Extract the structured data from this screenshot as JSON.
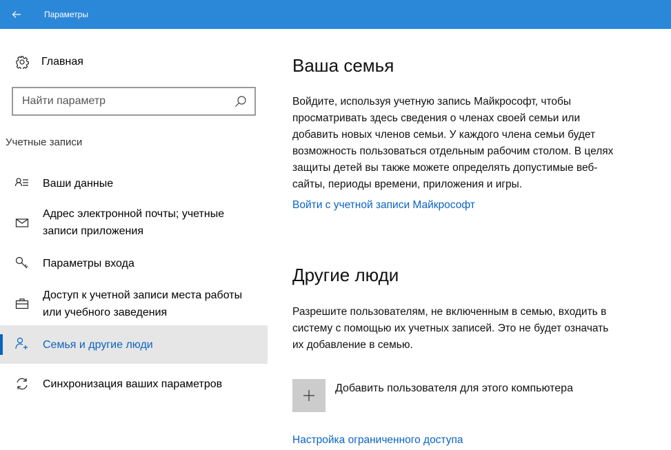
{
  "window": {
    "title": "Параметры",
    "back_icon": "back-arrow-icon"
  },
  "sidebar": {
    "home_label": "Главная",
    "search": {
      "placeholder": "Найти параметр"
    },
    "section_label": "Учетные записи",
    "items": [
      {
        "label_lines": [
          "Ваши данные"
        ],
        "icon": "person-list-icon"
      },
      {
        "label_lines": [
          "Адрес электронной почты; учетные",
          "записи приложения"
        ],
        "icon": "mail-icon"
      },
      {
        "label_lines": [
          "Параметры входа"
        ],
        "icon": "key-icon"
      },
      {
        "label_lines": [
          "Доступ к учетной записи места работы",
          "или учебного заведения"
        ],
        "icon": "briefcase-icon"
      },
      {
        "label_lines": [
          "Семья и другие люди"
        ],
        "icon": "add-person-icon",
        "active": true
      },
      {
        "label_lines": [
          "Синхронизация ваших параметров"
        ],
        "icon": "sync-icon"
      }
    ]
  },
  "main": {
    "family": {
      "heading": "Ваша семья",
      "lines": [
        "Войдите, используя учетную запись Майкрософт, чтобы",
        "просматривать здесь сведения о членах своей семьи или",
        "добавить новых членов семьи. У каждого члена семьи будет",
        "возможность пользоваться отдельным рабочим столом. В целях",
        "защиты детей вы также можете определять допустимые веб-",
        "сайты, периоды времени, приложения и игры."
      ],
      "link": "Войти с учетной записи Майкрософт"
    },
    "others": {
      "heading": "Другие люди",
      "lines": [
        "Разрешите пользователям, не включенным в семью, входить в",
        "систему с помощью их учетных записей. Это не будет означать",
        "их добавление в семью."
      ],
      "add_label": "Добавить пользователя для этого компьютера",
      "restricted_link": "Настройка ограниченного доступа"
    }
  },
  "colors": {
    "titlebar": "#2b88d8",
    "accent": "#0a64c2",
    "selected_bg": "#e6e6e6",
    "add_button_bg": "#cccccc"
  }
}
